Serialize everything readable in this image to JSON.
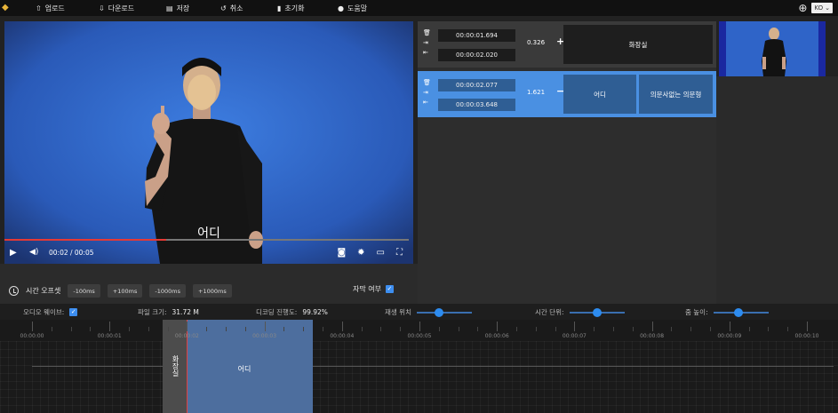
{
  "toolbar": {
    "upload": "업로드",
    "download": "다운로드",
    "save": "저장",
    "undo": "취소",
    "reset": "초기화",
    "help": "도움말",
    "language": "KO"
  },
  "player": {
    "subtitle": "어디",
    "time": "00:02 / 00:05",
    "progress_fraction": 0.4
  },
  "offset": {
    "label": "시간 오프셋",
    "buttons": [
      "-100ms",
      "+100ms",
      "-1000ms",
      "+1000ms"
    ]
  },
  "subtitle_toggle": {
    "label": "자막 여부",
    "checked": true
  },
  "subtitle_rows": [
    {
      "start": "00:00:01.694",
      "end": "00:00:02.020",
      "duration": "0.326",
      "action": "+",
      "texts": [
        "화장실"
      ]
    },
    {
      "start": "00:00:02.077",
      "end": "00:00:03.648",
      "duration": "1.621",
      "action": "−",
      "texts": [
        "어디",
        "의문사없는 의문형"
      ]
    }
  ],
  "infobar": {
    "waveform_label": "오디오 웨이브:",
    "filesize_label": "파일 크기:",
    "filesize_value": "31.72 M",
    "decode_label": "디코딩 진행도:",
    "decode_value": "99.92%",
    "playpos_label": "재생 위치",
    "timeunit_label": "시간 단위:",
    "zoom_label": "줌 높이:",
    "playpos_level": 0.4,
    "timeunit_level": 0.5,
    "zoom_level": 0.45
  },
  "timeline": {
    "ticks": [
      "00:00:00",
      "00:00:01",
      "00:00:02",
      "00:00:03",
      "00:00:04",
      "00:00:05",
      "00:00:06",
      "00:00:07",
      "00:00:08",
      "00:00:09",
      "00:00:10"
    ],
    "regions": [
      "화장실",
      "어디"
    ]
  },
  "colors": {
    "accent": "#4a90e2",
    "progress": "#e53935",
    "video_bg": "#1f2f52"
  },
  "icons": {
    "upload": "upload-icon",
    "download": "download-icon",
    "save": "save-icon",
    "undo": "undo-icon",
    "reset": "reset-icon",
    "help": "help-icon"
  }
}
